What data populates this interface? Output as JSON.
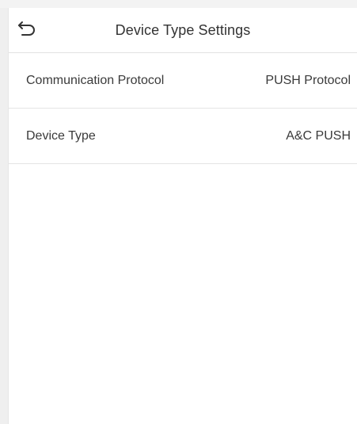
{
  "header": {
    "title": "Device Type Settings",
    "back_icon": "back-arrow-icon"
  },
  "settings": [
    {
      "label": "Communication Protocol",
      "value": "PUSH Protocol"
    },
    {
      "label": "Device Type",
      "value": "A&C PUSH"
    }
  ]
}
